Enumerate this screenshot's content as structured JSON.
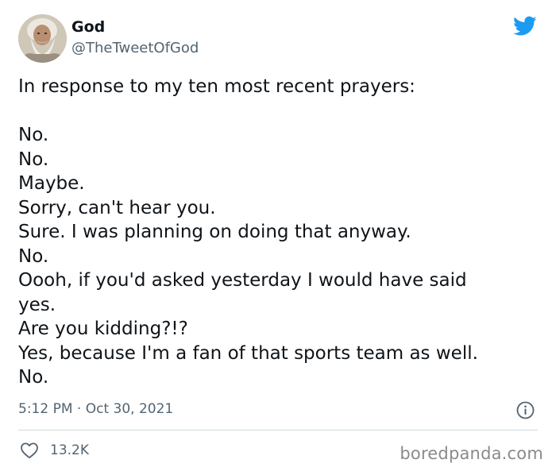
{
  "author": {
    "name": "God",
    "handle": "@TheTweetOfGod",
    "avatar_icon": "bearded-man-avatar"
  },
  "brand_icon": "twitter-bird-icon",
  "brand_color": "#1d9bf0",
  "tweet": {
    "intro": "In response to my ten most recent prayers:",
    "lines": [
      "No.",
      "No.",
      "Maybe.",
      "Sorry, can't hear you.",
      "Sure. I was planning on doing that anyway.",
      "No.",
      "Oooh, if you'd asked yesterday I would have said",
      "yes.",
      "Are you kidding?!?",
      "Yes, because I'm a fan of that sports team as well.",
      "No."
    ]
  },
  "meta": {
    "time": "5:12 PM",
    "separator": "·",
    "date": "Oct 30, 2021",
    "info_icon": "info-icon"
  },
  "actions": {
    "like_icon": "heart-icon",
    "like_count": "13.2K"
  },
  "watermark": "boredpanda.com"
}
